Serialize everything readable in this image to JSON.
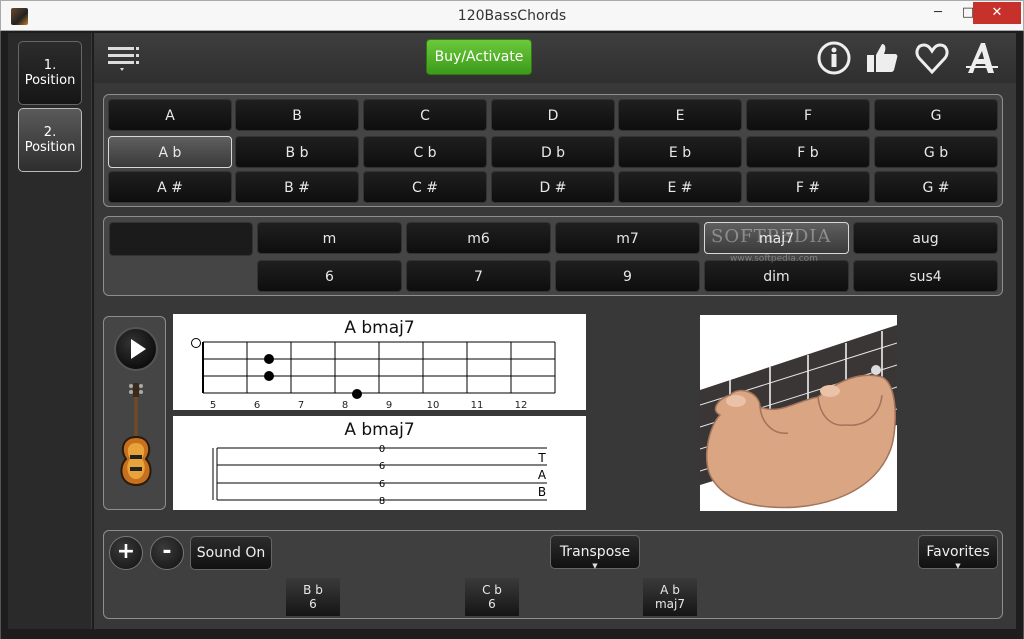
{
  "window": {
    "title": "120BassChords",
    "minimize": "─",
    "maximize": "□",
    "close": "✕"
  },
  "sidebar": {
    "items": [
      {
        "num": "1.",
        "label": "Position"
      },
      {
        "num": "2.",
        "label": "Position"
      }
    ]
  },
  "toolbar": {
    "buy_label": "Buy/Activate",
    "icons": [
      "menu-icon",
      "info-icon",
      "thumbs-up-icon",
      "heart-icon",
      "font-a-icon"
    ]
  },
  "roots": {
    "row1": [
      "A",
      "B",
      "C",
      "D",
      "E",
      "F",
      "G"
    ],
    "row2": [
      "A b",
      "B b",
      "C b",
      "D b",
      "E b",
      "F b",
      "G b"
    ],
    "row3": [
      "A #",
      "B #",
      "C #",
      "D #",
      "E #",
      "F #",
      "G #"
    ],
    "selected": "A b"
  },
  "types": {
    "row1": [
      "m",
      "m6",
      "m7",
      "maj7",
      "aug"
    ],
    "row2": [
      "6",
      "7",
      "9",
      "dim",
      "sus4"
    ],
    "selected": "maj7"
  },
  "diagram": {
    "title": "A bmaj7",
    "frets": [
      "5",
      "6",
      "7",
      "8",
      "9",
      "10",
      "11",
      "12"
    ]
  },
  "tab": {
    "title": "A bmaj7",
    "numbers": [
      "0",
      "6",
      "6",
      "8"
    ],
    "tab_letters": [
      "T",
      "A",
      "B"
    ]
  },
  "bottom": {
    "plus": "+",
    "minus": "-",
    "sound": "Sound On",
    "transpose": "Transpose",
    "favorites": "Favorites",
    "arrow": "▼",
    "chips": [
      {
        "root": "B b",
        "type": "6"
      },
      {
        "root": "C b",
        "type": "6"
      },
      {
        "root": "A b",
        "type": "maj7"
      }
    ]
  },
  "watermark": {
    "main": "SOFTPEDIA",
    "sub": "www.softpedia.com"
  }
}
